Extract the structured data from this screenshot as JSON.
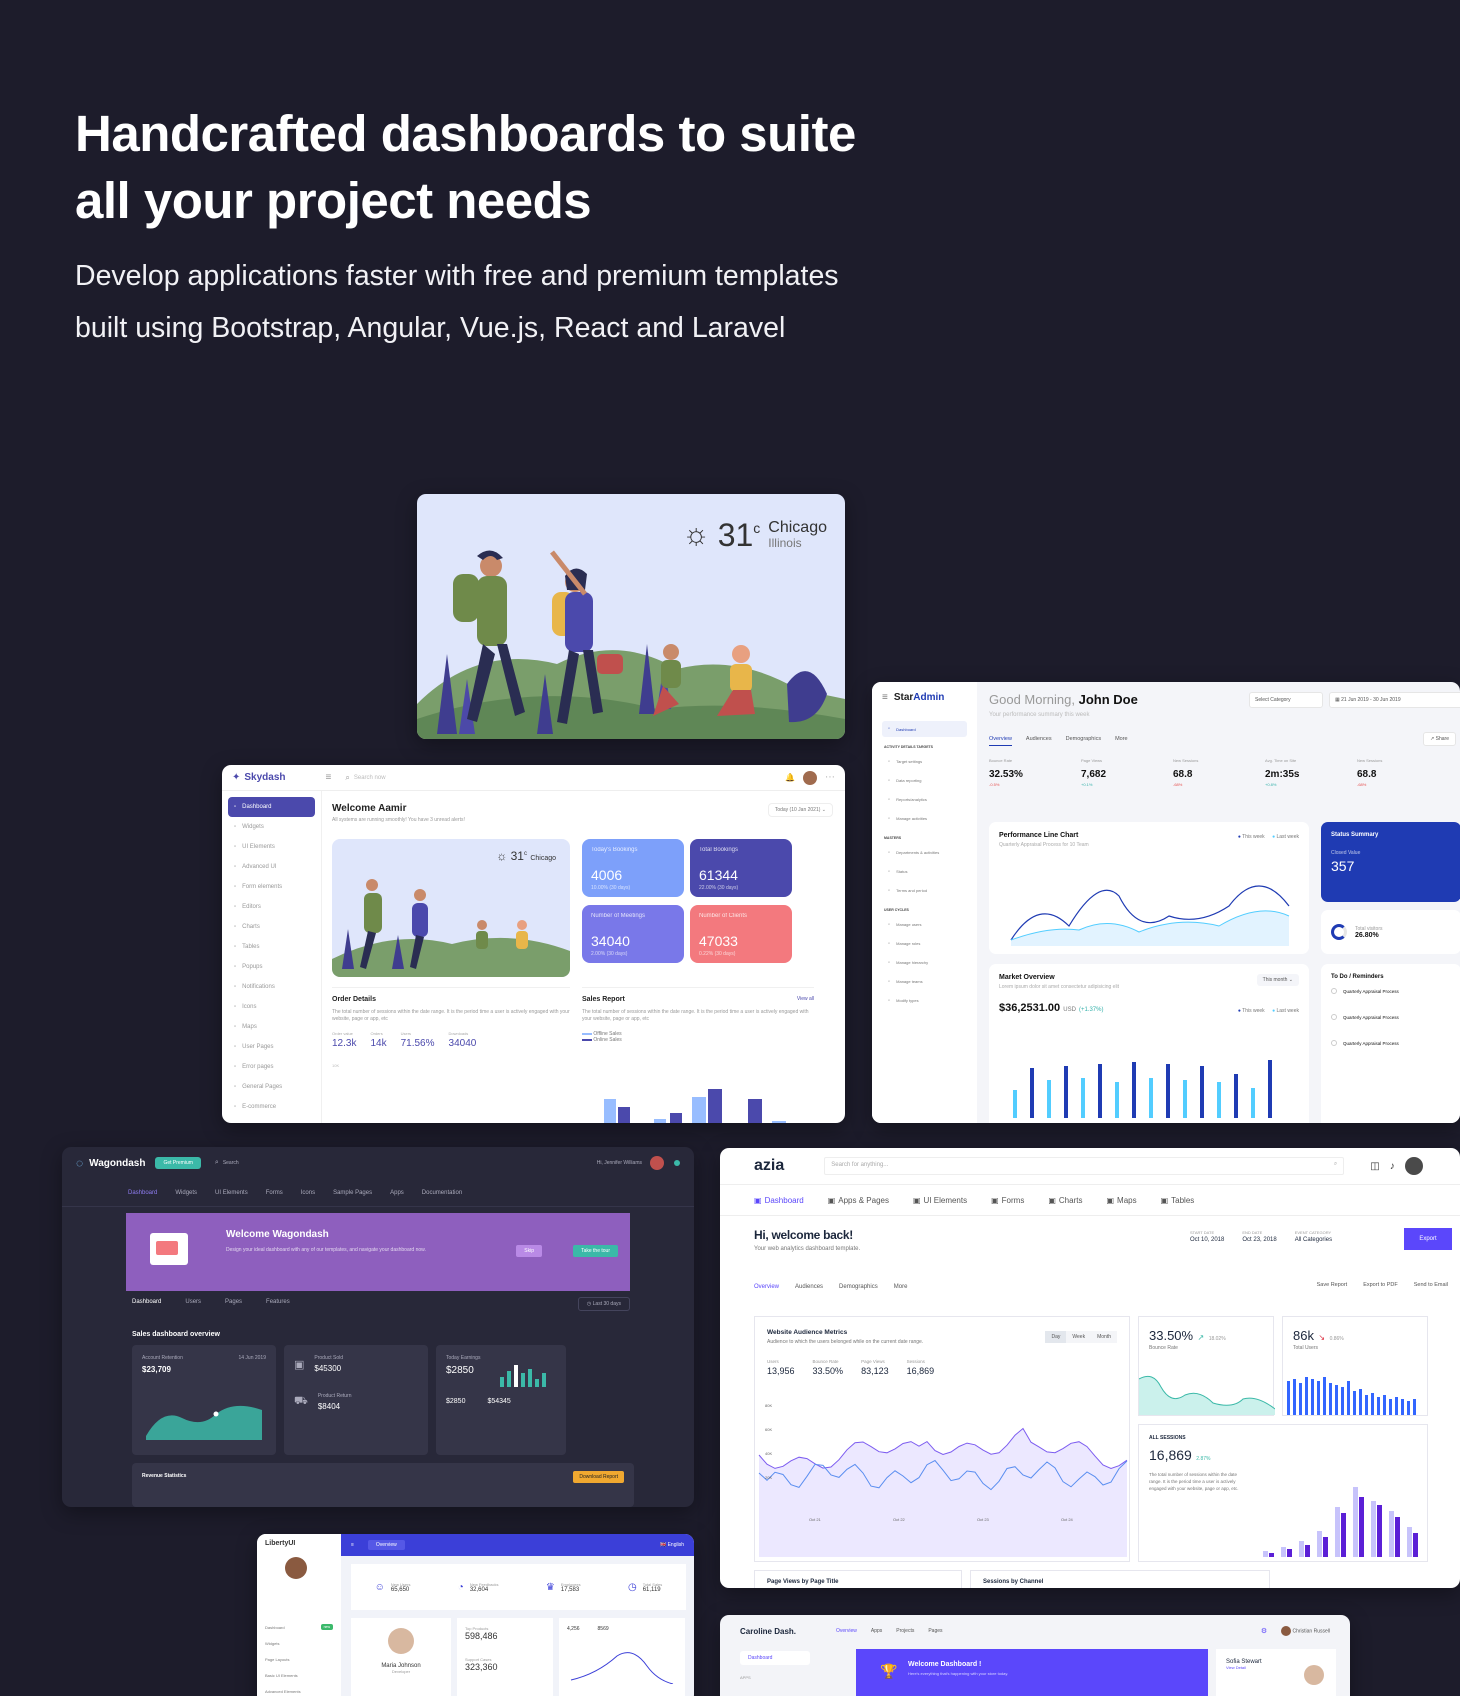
{
  "hero": {
    "title_line1": "Handcrafted dashboards to suite",
    "title_line2": "all your project needs",
    "subtitle_line1": "Develop applications faster with free and premium templates",
    "subtitle_line2": "built using Bootstrap, Angular, Vue.js, React and Laravel"
  },
  "weather": {
    "temp": "31",
    "unit": "c",
    "city": "Chicago",
    "state": "Illinois"
  },
  "skydash": {
    "brand": "Skydash",
    "search_placeholder": "Search now",
    "welcome": "Welcome Aamir",
    "welcome_sub": "All systems are running smoothly! You have 3 unread alerts!",
    "date_range": "Today (10 Jan 2021)",
    "sidebar": [
      "Dashboard",
      "Widgets",
      "UI Elements",
      "Advanced UI",
      "Form elements",
      "Editors",
      "Charts",
      "Tables",
      "Popups",
      "Notifications",
      "Icons",
      "Maps",
      "User Pages",
      "Error pages",
      "General Pages",
      "E-commerce"
    ],
    "tiles": [
      {
        "label": "Today's Bookings",
        "value": "4006",
        "sub": "10.00% (30 days)",
        "color": "#7da0fa"
      },
      {
        "label": "Total Bookings",
        "value": "61344",
        "sub": "22.00% (30 days)",
        "color": "#4b49ac"
      },
      {
        "label": "Number of Meetings",
        "value": "34040",
        "sub": "2.00% (30 days)",
        "color": "#7978e9"
      },
      {
        "label": "Number of Clients",
        "value": "47033",
        "sub": "0.22% (30 days)",
        "color": "#f3797e"
      }
    ],
    "order_title": "Order Details",
    "order_desc": "The total number of sessions within the date range. It is the period time a user is actively engaged with your website, page or app, etc",
    "order_stats": [
      {
        "label": "Order value",
        "value": "12.3k"
      },
      {
        "label": "Orders",
        "value": "14k"
      },
      {
        "label": "Users",
        "value": "71.56%"
      },
      {
        "label": "Downloads",
        "value": "34040"
      }
    ],
    "sales_title": "Sales Report",
    "sales_link": "View all",
    "sales_desc": "The total number of sessions within the date range. It is the period time a user is actively engaged with your website, page or app, etc",
    "legend": [
      "Offline Sales",
      "Online Sales"
    ]
  },
  "staradmin": {
    "brand_a": "Star",
    "brand_b": "Admin",
    "greeting": "Good Morning,",
    "user": "John Doe",
    "greeting_sub": "Your performance summary this week",
    "select": "Select Category",
    "date": "21 Jun 2019 - 30 Jun 2019",
    "tabs": [
      "Overview",
      "Audiences",
      "Demographics",
      "More"
    ],
    "share": "Share",
    "sidebar": [
      "Dashboard",
      "Target settings",
      "Data reporting",
      "Reports/analytics",
      "Manage activities",
      "Departments & activities",
      "Status",
      "Terms and period",
      "Manage users",
      "Manage roles",
      "Manage hierarchy",
      "Manage teams",
      "Modify types"
    ],
    "section_labels": [
      "ACTIVITY DETAILS TARGETS",
      "MASTERS",
      "USER CYCLES"
    ],
    "stats": [
      {
        "label": "Bounce Rate",
        "value": "32.53%",
        "delta": "-0.5%",
        "color": "#e65251"
      },
      {
        "label": "Page Views",
        "value": "7,682",
        "delta": "+0.1%",
        "color": "#34b1aa"
      },
      {
        "label": "New Sessions",
        "value": "68.8",
        "delta": "-68%",
        "color": "#e65251"
      },
      {
        "label": "Avg. Time on Site",
        "value": "2m:35s",
        "delta": "+0.8%",
        "color": "#34b1aa"
      },
      {
        "label": "New Sessions",
        "value": "68.8",
        "delta": "-68%",
        "color": "#e65251"
      }
    ],
    "perf_title": "Performance Line Chart",
    "perf_sub": "Quarterly Appraisal Process for 10 Team",
    "perf_legend": [
      "This week",
      "Last week"
    ],
    "status_title": "Status Summary",
    "status_label": "Closed Value",
    "status_value": "357",
    "total_visitors_label": "Total visitors",
    "total_visitors": "26.80%",
    "market_title": "Market Overview",
    "market_sub": "Lorem ipsum dolor sit amet consectetur adipisicing elit",
    "market_select": "This month",
    "market_value": "$36,2531.00",
    "market_unit": "USD",
    "market_delta": "(+1.37%)",
    "todo_title": "To Do / Reminders",
    "todo_items": [
      "Quarterly Appraisal Process",
      "Quarterly Appraisal Process",
      "Quarterly Appraisal Process"
    ]
  },
  "wagondash": {
    "brand": "Wagondash",
    "pill": "Get Premium",
    "search": "Search",
    "user": "Hi, Jennifer Williams",
    "nav": [
      "Dashboard",
      "Widgets",
      "UI Elements",
      "Forms",
      "Icons",
      "Sample Pages",
      "Apps",
      "Documentation"
    ],
    "welcome": "Welcome Wagondash",
    "welcome_sub": "Design your ideal dashboard with any of our templates, and navigate your dashboard now.",
    "btn_skip": "Skip",
    "btn_take": "Take the tour",
    "tabs": [
      "Dashboard",
      "Users",
      "Pages",
      "Features"
    ],
    "filter": "Last 30 days",
    "section_title": "Sales dashboard overview",
    "retention_label": "Account Retention",
    "retention_date": "14 Jun 2019",
    "retention_value": "$23,709",
    "product_sold_label": "Product Sold",
    "product_sold": "$45300",
    "product_return_label": "Product Return",
    "product_return": "$8404",
    "earnings_label": "Today Earnings",
    "earnings": "$2850",
    "mini_a": "$2850",
    "mini_b": "$54345",
    "revenue_title": "Revenue Statistics",
    "revenue_btn": "Download Report"
  },
  "azia": {
    "brand": "azia",
    "search_placeholder": "Search for anything...",
    "nav": [
      "Dashboard",
      "Apps & Pages",
      "UI Elements",
      "Forms",
      "Charts",
      "Maps",
      "Tables"
    ],
    "welcome": "Hi, welcome back!",
    "welcome_sub": "Your web analytics dashboard template.",
    "meta": [
      {
        "label": "START DATE",
        "value": "Oct 10, 2018"
      },
      {
        "label": "END DATE",
        "value": "Oct 23, 2018"
      },
      {
        "label": "EVENT CATEGORY",
        "value": "All Categories"
      }
    ],
    "export_btn": "Export",
    "tabs": [
      "Overview",
      "Audiences",
      "Demographics",
      "More"
    ],
    "actions": [
      "Save Report",
      "Export to PDF",
      "Send to Email"
    ],
    "metrics_title": "Website Audience Metrics",
    "metrics_sub": "Audience to which the users belonged while on the current date range.",
    "period_tabs": [
      "Day",
      "Week",
      "Month"
    ],
    "metrics": [
      {
        "label": "Users",
        "value": "13,956"
      },
      {
        "label": "Bounce Rate",
        "value": "33.50%"
      },
      {
        "label": "Page Views",
        "value": "83,123"
      },
      {
        "label": "Sessions",
        "value": "16,869"
      }
    ],
    "axis_ticks": [
      "Oct 21",
      "Oct 22",
      "Oct 23",
      "Oct 24"
    ],
    "y_ticks": [
      "80K",
      "60K",
      "40K",
      "20K"
    ],
    "bounce_value": "33.50%",
    "bounce_delta": "18.02%",
    "bounce_label": "Bounce Rate",
    "users_value": "86k",
    "users_delta": "0.86%",
    "users_label": "Total Users",
    "sessions_label": "ALL SESSIONS",
    "sessions_value": "16,869",
    "sessions_delta": "2.87%",
    "sessions_desc": "The total number of sessions within the date range. It is the period time a user is actively engaged with your website, page or app, etc.",
    "bottom_a": "Page Views by Page Title",
    "bottom_b": "Sessions by Channel"
  },
  "liberty": {
    "brand": "LibertyUI",
    "overview": "Overview",
    "lang": "English",
    "user": "Maria Johnson",
    "user_role": "Developer",
    "stats": [
      {
        "label": "New Users",
        "value": "65,650"
      },
      {
        "label": "New Feedbacks",
        "value": "32,604"
      },
      {
        "label": "Employees",
        "value": "17,583"
      },
      {
        "label": "Total Sales",
        "value": "61,119"
      }
    ],
    "sidebar": [
      "Dashboard",
      "Widgets",
      "Page Layouts",
      "Basic UI Elements",
      "Advanced Elements"
    ],
    "dashboard_badge": "new",
    "top_products_label": "Top Products",
    "top_products": "598,486",
    "support_cases_label": "Support Cases",
    "support_cases": "323,360",
    "mini_a": "4,256",
    "mini_b": "8569"
  },
  "caroline": {
    "brand": "Caroline Dash.",
    "nav": [
      "Overview",
      "Apps",
      "Projects",
      "Pages"
    ],
    "user": "Christian Russell",
    "sidebar": [
      "Dashboard",
      "APPS"
    ],
    "welcome": "Welcome Dashboard !",
    "welcome_sub": "Here's everything that's happening with your store today.",
    "person": "Sofia Stewart",
    "person_role": "View Detail"
  }
}
